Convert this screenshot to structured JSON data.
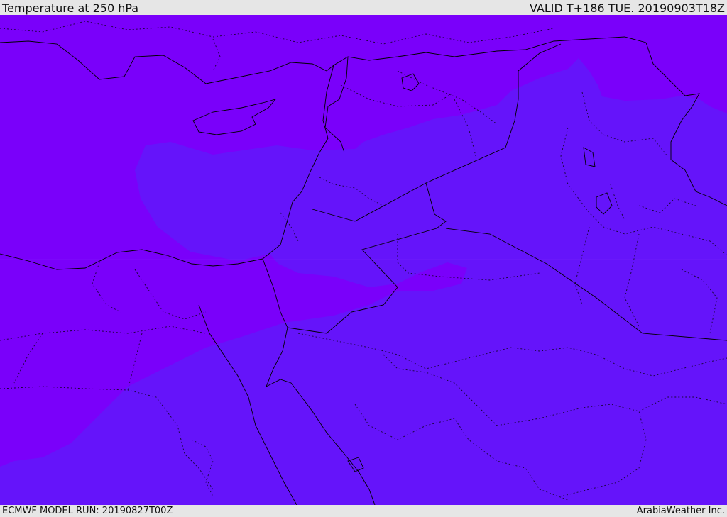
{
  "header": {
    "title": "Temperature at 250 hPa",
    "valid_time": "VALID T+186 TUE. 20190903T18Z"
  },
  "footer": {
    "model_run": "ECMWF MODEL RUN: 20190827T00Z",
    "credit": "ArabiaWeather Inc."
  },
  "map": {
    "colors": {
      "warmer_band": "#7a00fa",
      "cooler_band": "#6514fa",
      "boundaries": "#000000"
    }
  }
}
